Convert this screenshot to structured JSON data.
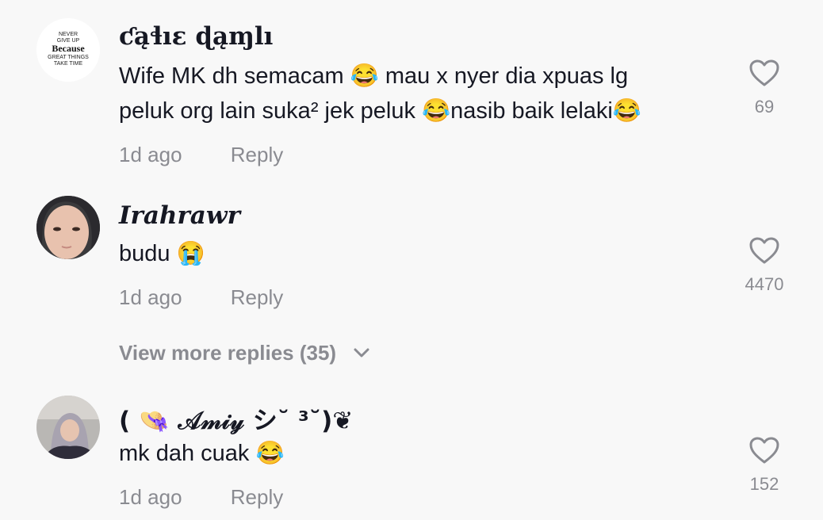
{
  "comments": [
    {
      "username": "ƈąɬıɛ ɖąɱlı",
      "avatar_text": [
        "NEVER",
        "GIVE UP",
        "Because",
        "GREAT THINGS",
        "TAKE TIME"
      ],
      "text_line1": "Wife MK dh semacam 😂 mau x nyer dia xpuas lg",
      "text_line2": "peluk org lain suka² jek peluk 😂nasib baik lelaki😂",
      "time": "1d ago",
      "reply_label": "Reply",
      "likes": "69",
      "icon": "heart-outline-icon"
    },
    {
      "username": "Irahrawr",
      "text_line1": "budu 😭",
      "time": "1d ago",
      "reply_label": "Reply",
      "likes": "4470",
      "icon": "heart-outline-icon"
    },
    {
      "username": "( 👒 𝒜𝓂𝒾𝓎 シ˘ ³˘)❦",
      "text_line1": "mk dah cuak 😂",
      "time": "1d ago",
      "reply_label": "Reply",
      "likes": "152",
      "icon": "heart-outline-icon"
    }
  ],
  "view_more": {
    "label": "View more replies (35)",
    "icon": "chevron-down-icon"
  },
  "colors": {
    "background": "#f8f8f8",
    "primary_text": "#161823",
    "secondary_text": "#8a8b91"
  }
}
